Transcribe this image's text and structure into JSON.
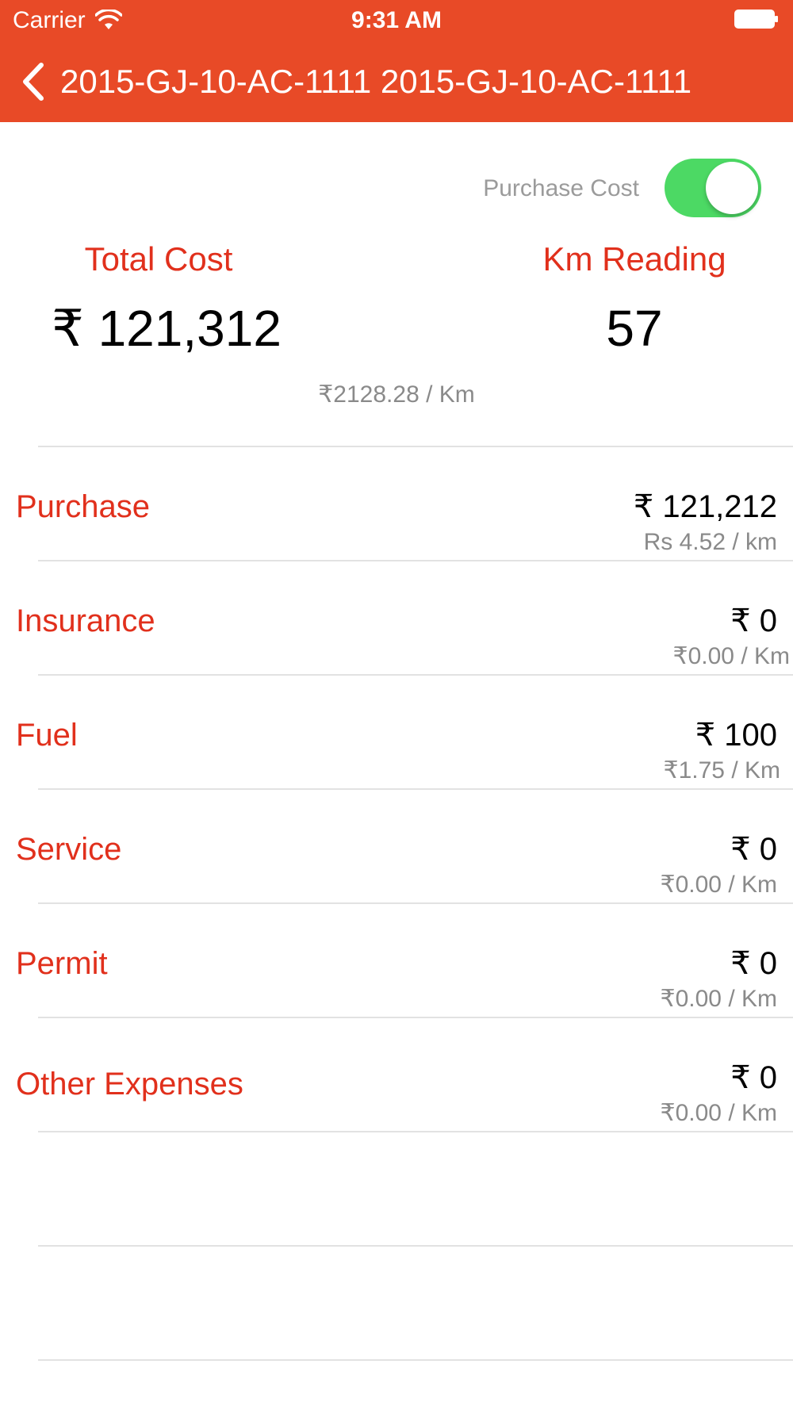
{
  "status_bar": {
    "carrier": "Carrier",
    "time": "9:31 AM"
  },
  "nav": {
    "title": "2015-GJ-10-AC-1111  2015-GJ-10-AC-1111"
  },
  "toggle": {
    "label": "Purchase Cost",
    "on": true
  },
  "summary": {
    "total_cost_label": "Total Cost",
    "total_cost_value": "₹ 121,312",
    "km_reading_label": "Km Reading",
    "km_reading_value": "57",
    "per_km": "₹2128.28 / Km"
  },
  "rows": [
    {
      "label": "Purchase",
      "amount": "₹ 121,212",
      "per_km": "Rs 4.52 / km"
    },
    {
      "label": "Insurance",
      "amount": "₹ 0",
      "per_km": "₹0.00 / Km"
    },
    {
      "label": "Fuel",
      "amount": "₹ 100",
      "per_km": "₹1.75 / Km"
    },
    {
      "label": "Service",
      "amount": "₹ 0",
      "per_km": "₹0.00 / Km"
    },
    {
      "label": "Permit",
      "amount": "₹ 0",
      "per_km": "₹0.00 / Km"
    },
    {
      "label": "Other Expenses",
      "amount": "₹ 0",
      "per_km": "₹0.00 / Km"
    }
  ],
  "colors": {
    "header": "#E84A27",
    "accent_text": "#E1301C",
    "toggle_on": "#4CD964"
  }
}
